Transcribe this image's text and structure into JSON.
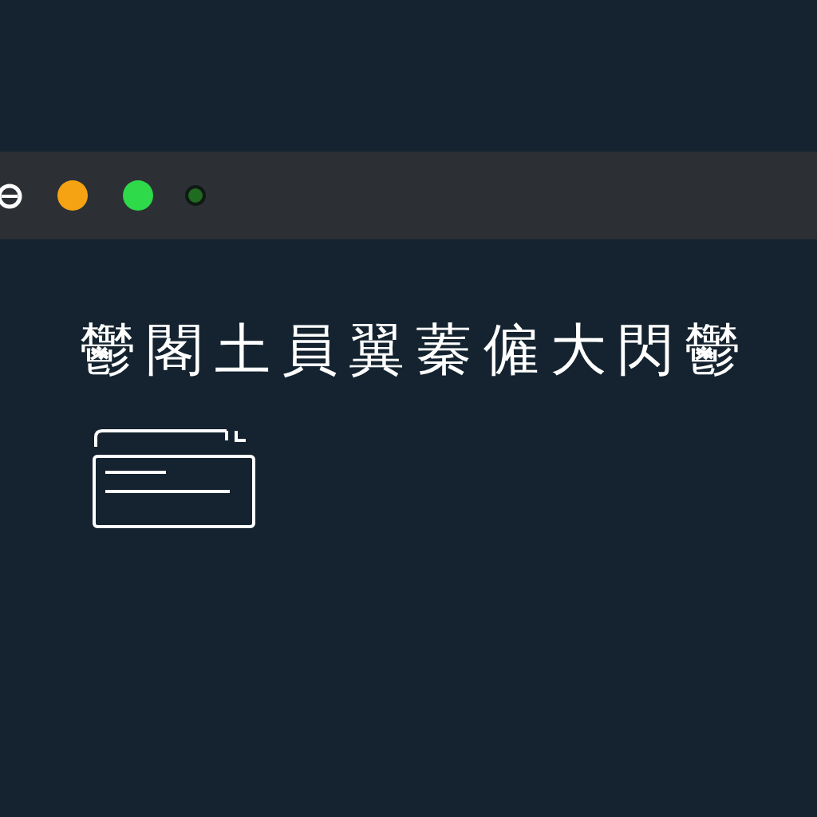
{
  "toolbar": {
    "buttons": [
      {
        "kind": "logo"
      },
      {
        "kind": "dot",
        "color": "#f5a313"
      },
      {
        "kind": "dot",
        "color": "#2ed94a"
      },
      {
        "kind": "small",
        "color": "#1f6b1f"
      }
    ]
  },
  "heading": "鬱 閣 土 員 翼 蓁 僱 大 閃 鬱"
}
